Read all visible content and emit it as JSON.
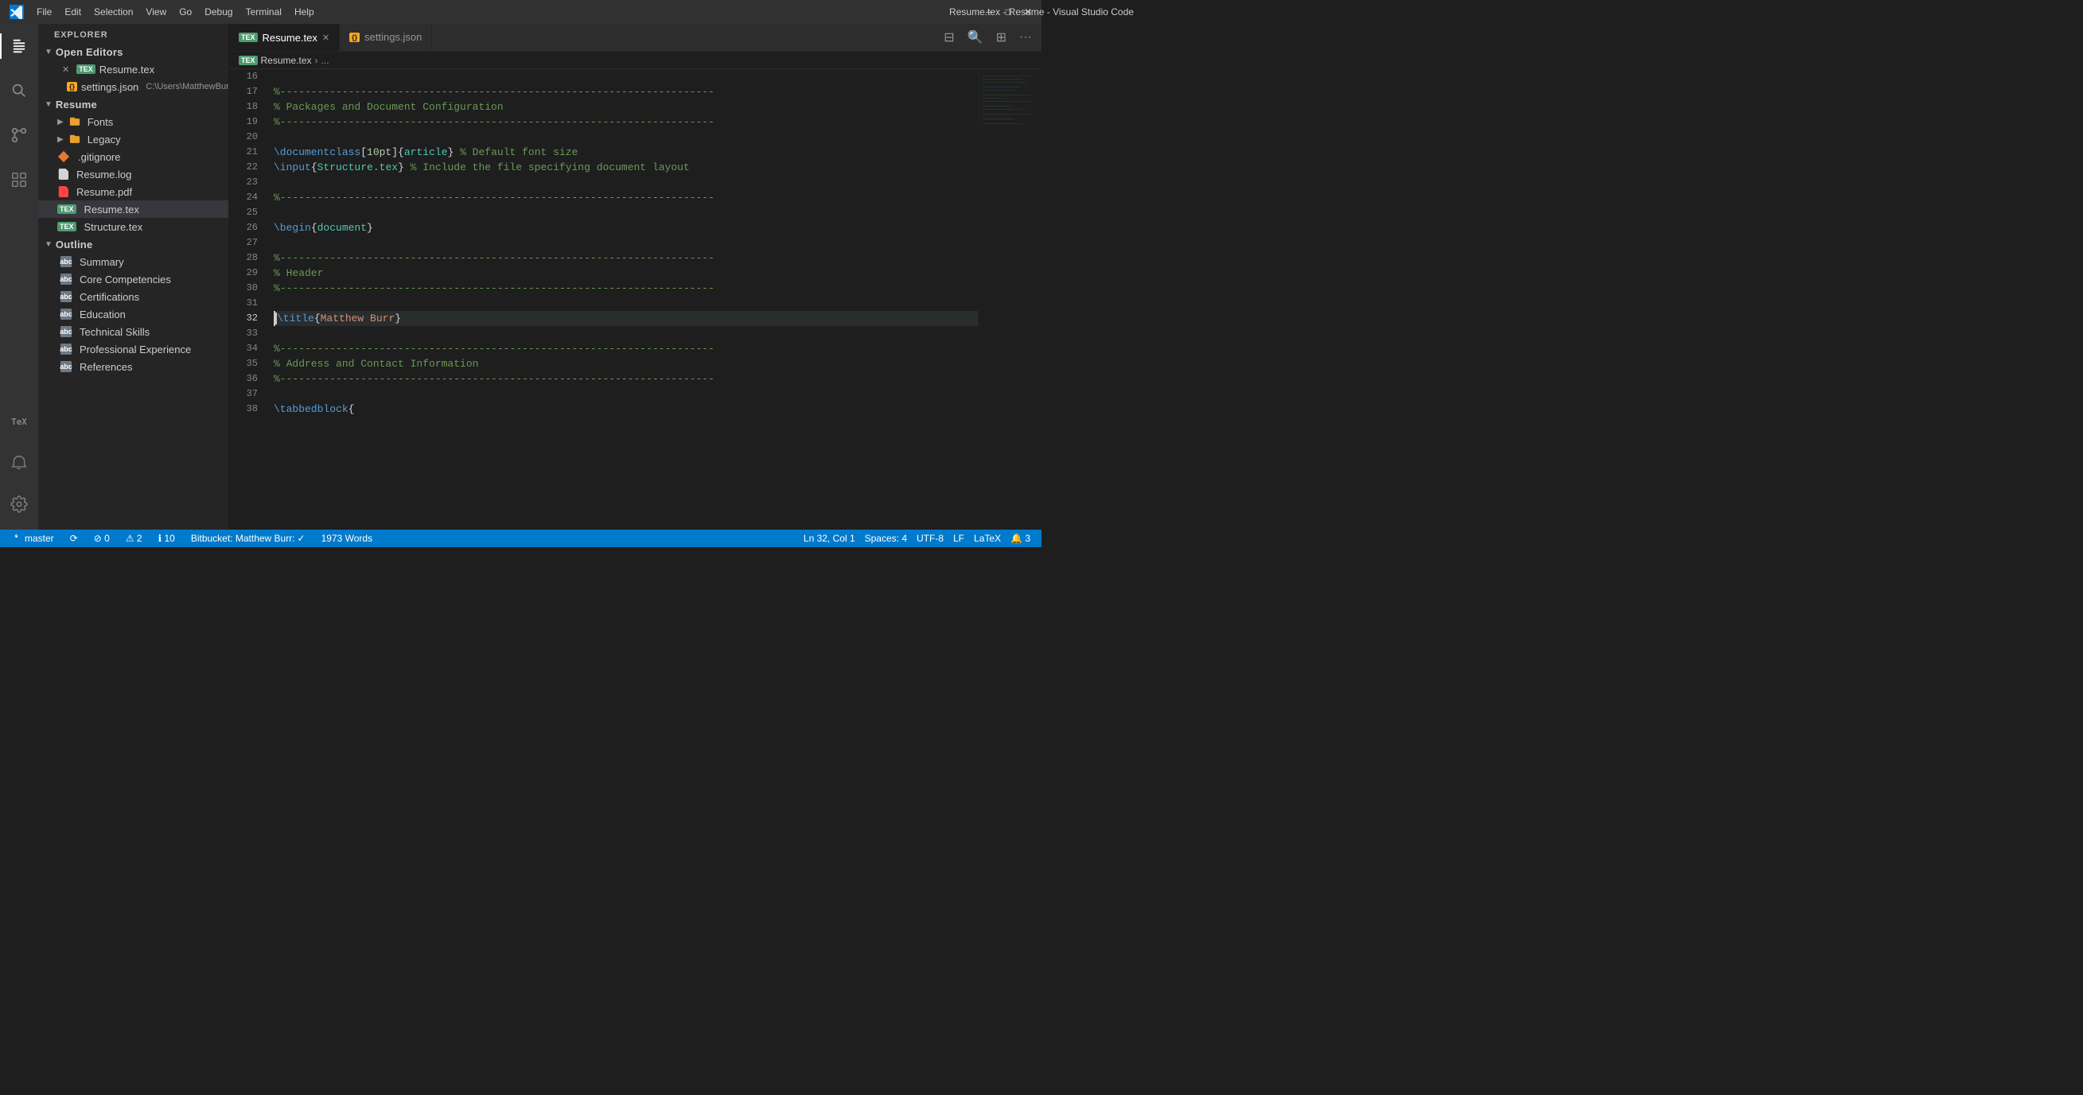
{
  "window": {
    "title": "Resume.tex - Resume - Visual Studio Code",
    "minimize": "─",
    "maximize": "□",
    "close": "✕"
  },
  "menu": {
    "items": [
      "File",
      "Edit",
      "Selection",
      "View",
      "Go",
      "Debug",
      "Terminal",
      "Help"
    ]
  },
  "activity_bar": {
    "icons": [
      {
        "name": "explorer",
        "symbol": "⎘",
        "active": true
      },
      {
        "name": "search",
        "symbol": "🔍"
      },
      {
        "name": "source-control",
        "symbol": "⎇"
      },
      {
        "name": "extensions",
        "symbol": "⊞"
      },
      {
        "name": "tex",
        "symbol": "TeX"
      },
      {
        "name": "alerts",
        "symbol": "🔔"
      },
      {
        "name": "gear",
        "symbol": "⚙"
      }
    ]
  },
  "sidebar": {
    "header": "Explorer",
    "open_editors": {
      "label": "Open Editors",
      "items": [
        {
          "name": "Resume.tex",
          "type": "tex",
          "active": true
        },
        {
          "name": "settings.json",
          "type": "json",
          "path": "C:\\Users\\MatthewBur..."
        }
      ]
    },
    "resume_folder": {
      "label": "Resume",
      "items": [
        {
          "name": "Fonts",
          "type": "folder"
        },
        {
          "name": "Legacy",
          "type": "folder"
        },
        {
          "name": ".gitignore",
          "type": "gitignore"
        },
        {
          "name": "Resume.log",
          "type": "log"
        },
        {
          "name": "Resume.pdf",
          "type": "pdf"
        },
        {
          "name": "Resume.tex",
          "type": "tex",
          "active": true
        },
        {
          "name": "Structure.tex",
          "type": "tex"
        }
      ]
    },
    "outline": {
      "label": "Outline",
      "items": [
        {
          "name": "Summary"
        },
        {
          "name": "Core Competencies"
        },
        {
          "name": "Certifications"
        },
        {
          "name": "Education"
        },
        {
          "name": "Technical Skills"
        },
        {
          "name": "Professional Experience"
        },
        {
          "name": "References"
        }
      ]
    }
  },
  "tabs": [
    {
      "name": "Resume.tex",
      "type": "tex",
      "active": true,
      "has_close": true
    },
    {
      "name": "settings.json",
      "type": "json",
      "active": false,
      "has_close": false
    }
  ],
  "breadcrumb": {
    "file": "Resume.tex",
    "separator": "›",
    "path": "..."
  },
  "editor": {
    "lines": [
      {
        "num": "16",
        "content": "",
        "tokens": []
      },
      {
        "num": "17",
        "content": "%----------------------------------------------------------------------",
        "tokens": [
          {
            "type": "tok-dashed",
            "text": "%----------------------------------------------------------------------"
          }
        ]
      },
      {
        "num": "18",
        "content": "% Packages and Document Configuration",
        "tokens": [
          {
            "type": "tok-comment",
            "text": "% Packages and Document Configuration"
          }
        ]
      },
      {
        "num": "19",
        "content": "%----------------------------------------------------------------------",
        "tokens": [
          {
            "type": "tok-dashed",
            "text": "%----------------------------------------------------------------------"
          }
        ]
      },
      {
        "num": "20",
        "content": "",
        "tokens": []
      },
      {
        "num": "21",
        "content": "\\documentclass[10pt]{article} % Default font size",
        "tokens": [
          {
            "type": "tok-command",
            "text": "\\documentclass"
          },
          {
            "type": "tok-brace",
            "text": "["
          },
          {
            "type": "tok-opt",
            "text": "10pt"
          },
          {
            "type": "tok-brace",
            "text": "]{"
          },
          {
            "type": "tok-arg2",
            "text": "article"
          },
          {
            "type": "tok-brace",
            "text": "}"
          },
          {
            "type": "tok-comment",
            "text": " % Default font size"
          }
        ]
      },
      {
        "num": "22",
        "content": "\\input{Structure.tex} % Include the file specifying document layout",
        "tokens": [
          {
            "type": "tok-command",
            "text": "\\input"
          },
          {
            "type": "tok-brace",
            "text": "{"
          },
          {
            "type": "tok-arg2",
            "text": "Structure.tex"
          },
          {
            "type": "tok-brace",
            "text": "}"
          },
          {
            "type": "tok-comment",
            "text": " % Include the file specifying document layout"
          }
        ]
      },
      {
        "num": "23",
        "content": "",
        "tokens": []
      },
      {
        "num": "24",
        "content": "%----------------------------------------------------------------------",
        "tokens": [
          {
            "type": "tok-dashed",
            "text": "%----------------------------------------------------------------------"
          }
        ]
      },
      {
        "num": "25",
        "content": "",
        "tokens": []
      },
      {
        "num": "26",
        "content": "\\begin{document}",
        "tokens": [
          {
            "type": "tok-command",
            "text": "\\begin"
          },
          {
            "type": "tok-brace",
            "text": "{"
          },
          {
            "type": "tok-arg2",
            "text": "document"
          },
          {
            "type": "tok-brace",
            "text": "}"
          }
        ]
      },
      {
        "num": "27",
        "content": "",
        "tokens": []
      },
      {
        "num": "28",
        "content": "%----------------------------------------------------------------------",
        "tokens": [
          {
            "type": "tok-dashed",
            "text": "%----------------------------------------------------------------------"
          }
        ]
      },
      {
        "num": "29",
        "content": "% Header",
        "tokens": [
          {
            "type": "tok-comment",
            "text": "% Header"
          }
        ]
      },
      {
        "num": "30",
        "content": "%----------------------------------------------------------------------",
        "tokens": [
          {
            "type": "tok-dashed",
            "text": "%----------------------------------------------------------------------"
          }
        ]
      },
      {
        "num": "31",
        "content": "",
        "tokens": []
      },
      {
        "num": "32",
        "content": "\\title{Matthew Burr}",
        "tokens": [
          {
            "type": "tok-command",
            "text": "\\title"
          },
          {
            "type": "tok-brace",
            "text": "{"
          },
          {
            "type": "tok-arg",
            "text": "Matthew Burr"
          },
          {
            "type": "tok-brace",
            "text": "}"
          }
        ],
        "cursor": true
      },
      {
        "num": "33",
        "content": "",
        "tokens": []
      },
      {
        "num": "34",
        "content": "%----------------------------------------------------------------------",
        "tokens": [
          {
            "type": "tok-dashed",
            "text": "%----------------------------------------------------------------------"
          }
        ]
      },
      {
        "num": "35",
        "content": "% Address and Contact Information",
        "tokens": [
          {
            "type": "tok-comment",
            "text": "% Address and Contact Information"
          }
        ]
      },
      {
        "num": "36",
        "content": "%----------------------------------------------------------------------",
        "tokens": [
          {
            "type": "tok-dashed",
            "text": "%----------------------------------------------------------------------"
          }
        ]
      },
      {
        "num": "37",
        "content": "",
        "tokens": []
      },
      {
        "num": "38",
        "content": "\\tabbedblock{",
        "tokens": [
          {
            "type": "tok-command",
            "text": "\\tabbedblock"
          },
          {
            "type": "tok-brace",
            "text": "{"
          }
        ]
      }
    ]
  },
  "status_bar": {
    "branch": "master",
    "sync_icon": "⟳",
    "errors": "⊘ 0",
    "warnings": "⚠ 2",
    "info": "ℹ 10",
    "bitbucket": "Bitbucket: Matthew Burr:",
    "check": "✓",
    "words": "1973 Words",
    "position": "Ln 32, Col 1",
    "spaces": "Spaces: 4",
    "encoding": "UTF-8",
    "line_ending": "LF",
    "language": "LaTeX",
    "notifications": "🔔 3"
  }
}
